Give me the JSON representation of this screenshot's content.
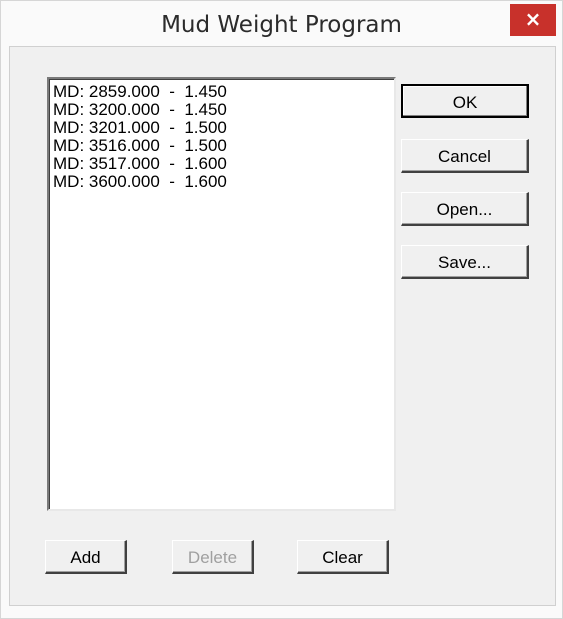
{
  "window": {
    "title": "Mud Weight Program",
    "close_label": "×"
  },
  "list": {
    "items": [
      "MD: 2859.000  -  1.450",
      "MD: 3200.000  -  1.450",
      "MD: 3201.000  -  1.500",
      "MD: 3516.000  -  1.500",
      "MD: 3517.000  -  1.600",
      "MD: 3600.000  -  1.600"
    ]
  },
  "buttons": {
    "ok": "OK",
    "cancel": "Cancel",
    "open": "Open...",
    "save": "Save...",
    "add": "Add",
    "delete": "Delete",
    "clear": "Clear"
  }
}
